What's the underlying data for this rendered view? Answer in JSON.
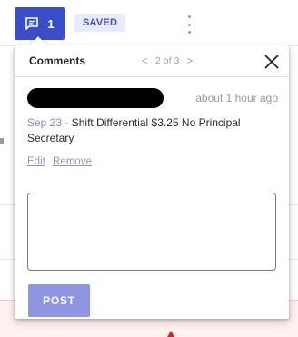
{
  "toolbar": {
    "comment_count": "1",
    "saved_label": "SAVED"
  },
  "popover": {
    "title": "Comments",
    "pager": {
      "prev": "<",
      "position": "2 of 3",
      "next": ">"
    },
    "comment": {
      "timestamp": "about 1 hour ago",
      "date": "Sep 23",
      "separator": " - ",
      "body": "Shift Differential $3.25 No Principal Secretary",
      "edit_label": "Edit",
      "remove_label": "Remove"
    },
    "reply": {
      "value": "",
      "placeholder": ""
    },
    "post_label": "POST"
  },
  "colors": {
    "primary": "#3a4ec8",
    "post_disabled": "#8e96e4",
    "date_accent": "#7f8bd1"
  }
}
